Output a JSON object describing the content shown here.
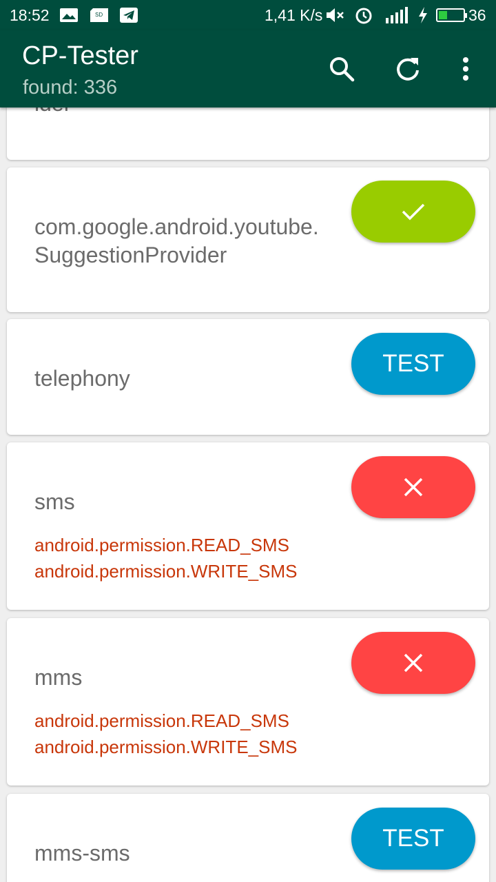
{
  "status_bar": {
    "time": "18:52",
    "network_speed": "1,41 K/s",
    "battery_level": "36",
    "icons": [
      "image-notification-icon",
      "sd-card-icon",
      "telegram-icon",
      "mute-icon",
      "alarm-icon",
      "signal-icon",
      "charging-icon",
      "battery-icon"
    ]
  },
  "app_bar": {
    "title": "CP-Tester",
    "subtitle": "found: 336",
    "actions": [
      "search-icon",
      "refresh-icon",
      "more-vert-icon"
    ]
  },
  "colors": {
    "primary_dark": "#004d3d",
    "success": "#99cc00",
    "test": "#0099cc",
    "fail": "#ff4444",
    "permission_text": "#c8370a"
  },
  "providers": [
    {
      "name": "ider",
      "status": "none",
      "permissions": []
    },
    {
      "name": "com.google.android.youtube.SuggestionProvider",
      "status": "success",
      "button": "",
      "permissions": []
    },
    {
      "name": "telephony",
      "status": "test",
      "button": "TEST",
      "permissions": []
    },
    {
      "name": "sms",
      "status": "fail",
      "button": "",
      "permissions": [
        "android.permission.READ_SMS",
        "android.permission.WRITE_SMS"
      ]
    },
    {
      "name": "mms",
      "status": "fail",
      "button": "",
      "permissions": [
        "android.permission.READ_SMS",
        "android.permission.WRITE_SMS"
      ]
    },
    {
      "name": "mms-sms",
      "status": "test",
      "button": "TEST",
      "permissions": []
    }
  ]
}
